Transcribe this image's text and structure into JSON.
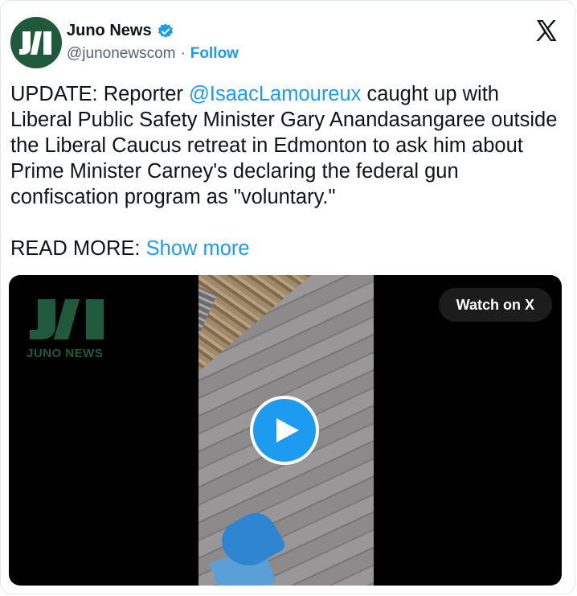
{
  "author": {
    "name": "Juno News",
    "handle": "@junonewscom",
    "separator": "·",
    "follow_label": "Follow",
    "avatar_text": "J1",
    "brand_color": "#1f5a3c",
    "verified_color": "#1d9bf0"
  },
  "tweet": {
    "prefix": "UPDATE: Reporter ",
    "mention": "@IsaacLamoureux",
    "body": " caught up with Liberal Public Safety Minister Gary Anandasangaree outside the Liberal Caucus retreat in Edmonton to ask him about Prime Minister Carney's declaring the federal gun confiscation program as \"voluntary.\"",
    "read_more_label": "READ MORE:",
    "show_more_label": "Show more"
  },
  "media": {
    "logo_word": "JUNO NEWS",
    "watch_label": "Watch on X",
    "play_icon": "play-icon"
  },
  "icons": {
    "platform": "x-logo-icon",
    "verified": "verified-badge-icon"
  },
  "colors": {
    "link": "#1d9bf0",
    "text": "#0f1419",
    "secondary": "#536471"
  }
}
